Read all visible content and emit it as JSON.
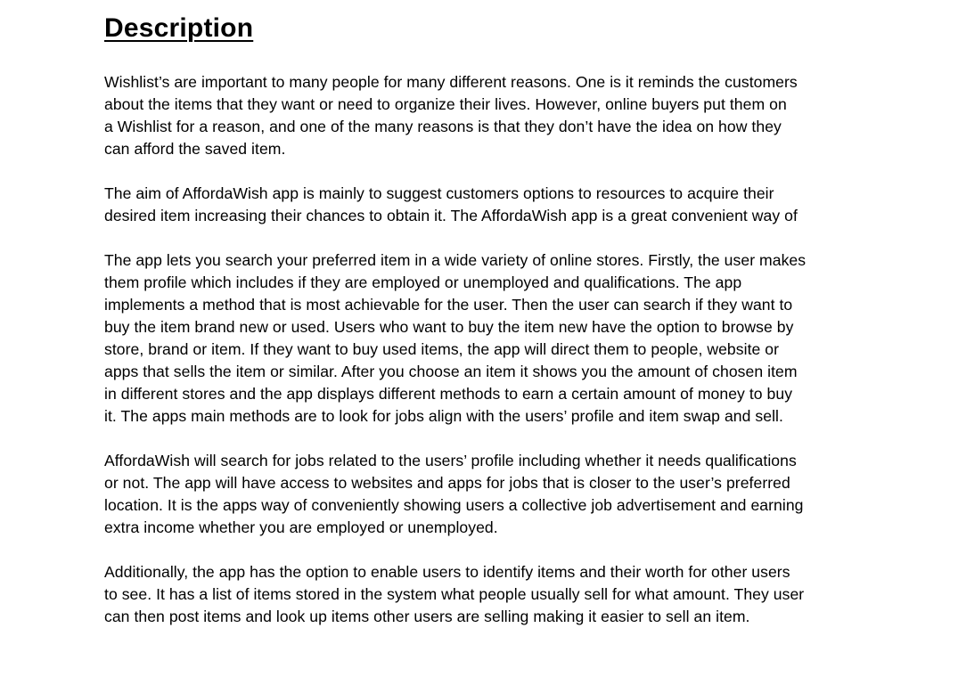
{
  "document": {
    "title": "Description",
    "paragraphs": [
      {
        "lines": [
          "Wishlist’s are important to many people for many different reasons. One is it reminds the customers",
          "about the items that they want or need to organize their lives. However, online buyers put them on",
          "a Wishlist for a reason, and one of the many reasons is that they don’t have the idea on how they",
          "can afford the saved item."
        ]
      },
      {
        "lines": [
          "The aim of AffordaWish app is mainly to suggest customers options to resources to acquire their",
          "desired item increasing their chances to obtain it. The AffordaWish app is a great convenient way of"
        ]
      },
      {
        "lines": [
          "The app lets you search your preferred item in a wide variety of online stores. Firstly, the user makes",
          "them profile which includes if they are employed or unemployed and qualifications. The app",
          "implements a method that is most achievable for the user. Then the user can search if they want to",
          "buy the item brand new or used. Users who want to buy the item new have the option to browse by",
          "store, brand or item. If they want to buy used items, the app will direct them to people, website or",
          "apps that sells the item or similar. After you choose an item it shows you the amount of chosen item",
          "in different stores and the app displays different methods to earn a certain amount of money to buy",
          "it. The apps main methods are to look for jobs align with the users’ profile and item swap and sell."
        ]
      },
      {
        "lines": [
          "AffordaWish will search for jobs related to the users’ profile including whether it needs qualifications",
          "or not. The app will have access to websites and apps for jobs that is closer to the user’s preferred",
          "location. It is the apps way of conveniently showing users a collective job advertisement and earning",
          "extra income whether you are employed or unemployed."
        ]
      },
      {
        "lines": [
          "Additionally, the app has the option to enable users to identify items and their worth for other users",
          "to see. It has a list of items stored in the system what people usually sell for what amount. They user",
          "can then post items and look up items other users are selling making it easier to sell an item."
        ]
      }
    ]
  }
}
